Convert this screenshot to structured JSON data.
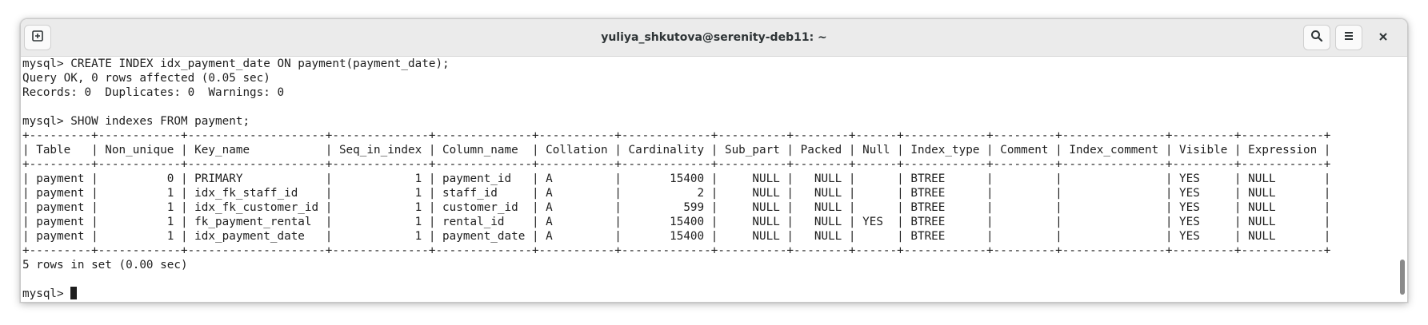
{
  "window": {
    "title": "yuliya_shkutova@serenity-deb11: ~"
  },
  "icons": {
    "new_tab": "new-tab-icon",
    "search": "search-icon",
    "menu": "hamburger-menu-icon",
    "close": "close-icon"
  },
  "terminal": {
    "lines": [
      "mysql> CREATE INDEX idx_payment_date ON payment(payment_date);",
      "Query OK, 0 rows affected (0.05 sec)",
      "Records: 0  Duplicates: 0  Warnings: 0",
      "",
      "mysql> SHOW indexes FROM payment;",
      "+---------+------------+--------------------+--------------+--------------+-----------+-------------+----------+--------+------+------------+---------+---------------+---------+------------+",
      "| Table   | Non_unique | Key_name           | Seq_in_index | Column_name  | Collation | Cardinality | Sub_part | Packed | Null | Index_type | Comment | Index_comment | Visible | Expression |",
      "+---------+------------+--------------------+--------------+--------------+-----------+-------------+----------+--------+------+------------+---------+---------------+---------+------------+",
      "| payment |          0 | PRIMARY            |            1 | payment_id   | A         |       15400 |     NULL |   NULL |      | BTREE      |         |               | YES     | NULL       |",
      "| payment |          1 | idx_fk_staff_id    |            1 | staff_id     | A         |           2 |     NULL |   NULL |      | BTREE      |         |               | YES     | NULL       |",
      "| payment |          1 | idx_fk_customer_id |            1 | customer_id  | A         |         599 |     NULL |   NULL |      | BTREE      |         |               | YES     | NULL       |",
      "| payment |          1 | fk_payment_rental  |            1 | rental_id    | A         |       15400 |     NULL |   NULL | YES  | BTREE      |         |               | YES     | NULL       |",
      "| payment |          1 | idx_payment_date   |            1 | payment_date | A         |       15400 |     NULL |   NULL |      | BTREE      |         |               | YES     | NULL       |",
      "+---------+------------+--------------------+--------------+--------------+-----------+-------------+----------+--------+------+------------+---------+---------------+---------+------------+",
      "5 rows in set (0.00 sec)",
      "",
      "mysql> "
    ]
  }
}
